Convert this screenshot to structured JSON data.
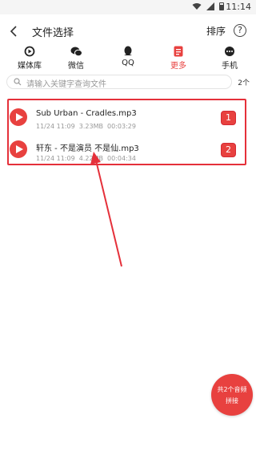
{
  "status": {
    "time": "11:14"
  },
  "header": {
    "title": "文件选择",
    "sort_label": "排序",
    "help_label": "?"
  },
  "tabs": [
    {
      "label": "媒体库",
      "icon": "media-library-icon",
      "active": false
    },
    {
      "label": "微信",
      "icon": "wechat-icon",
      "active": false
    },
    {
      "label": "QQ",
      "icon": "qq-icon",
      "active": false
    },
    {
      "label": "更多",
      "icon": "more-doc-icon",
      "active": true
    },
    {
      "label": "手机",
      "icon": "phone-icon",
      "active": false
    }
  ],
  "search": {
    "placeholder": "请输入关键字查询文件",
    "count": "2个"
  },
  "files": [
    {
      "name": "Sub Urban - Cradles.mp3",
      "date": "11/24 11:09",
      "size": "3.23MB",
      "duration": "00:03:29",
      "index": "1"
    },
    {
      "name": "轩东 - 不是演员 不是仙.mp3",
      "date": "11/24 11:09",
      "size": "4.22MB",
      "duration": "00:04:34",
      "index": "2"
    }
  ],
  "fab": {
    "line1": "共2个音频",
    "line2": "拼接"
  },
  "colors": {
    "accent": "#e8413f",
    "annotation": "#e5303a"
  }
}
